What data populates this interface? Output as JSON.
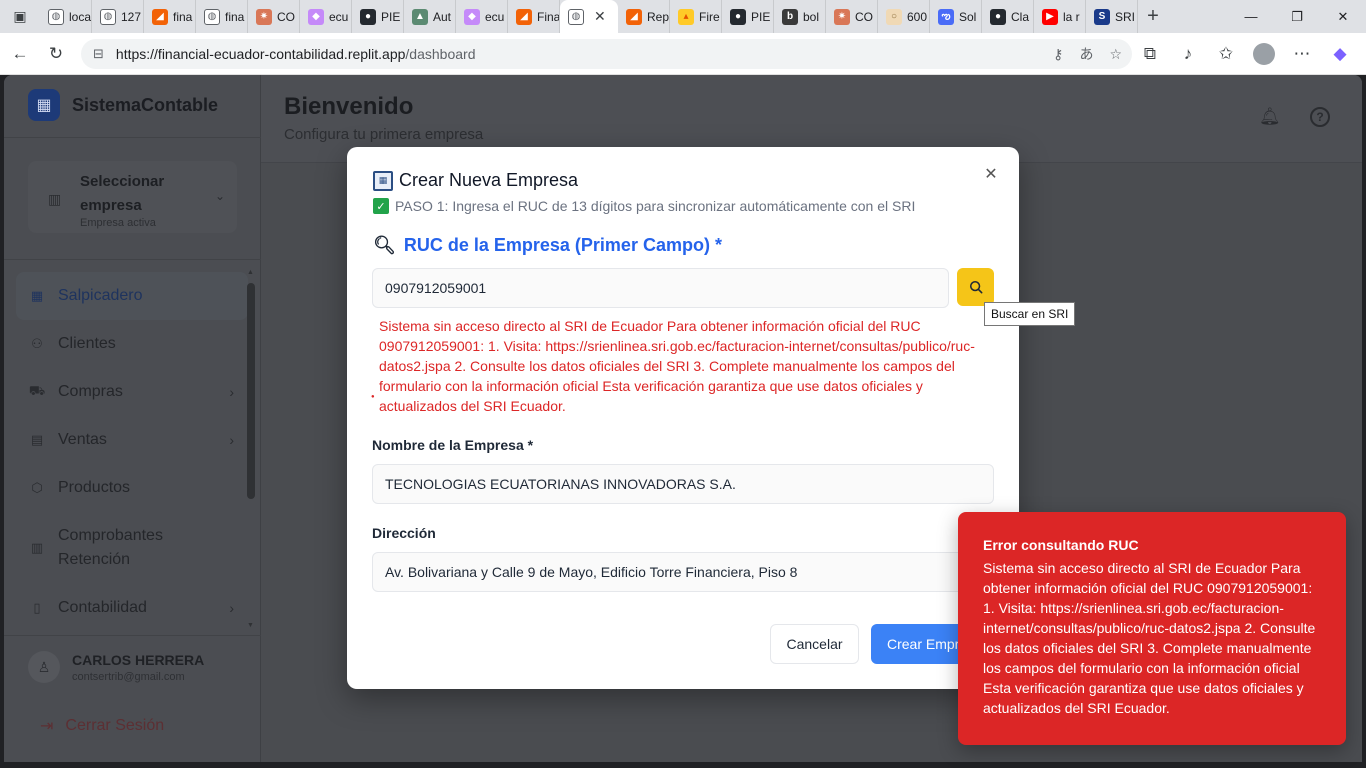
{
  "browser": {
    "tabs": [
      {
        "label": "loca",
        "icon": "globe-icon"
      },
      {
        "label": "127",
        "icon": "globe-icon"
      },
      {
        "label": "fina",
        "icon": "replit-icon"
      },
      {
        "label": "fina",
        "icon": "globe-icon"
      },
      {
        "label": "CO",
        "icon": "claude-icon"
      },
      {
        "label": "ecu",
        "icon": "gemini-icon"
      },
      {
        "label": "PIE",
        "icon": "github-icon"
      },
      {
        "label": "Aut",
        "icon": "app-icon"
      },
      {
        "label": "ecu",
        "icon": "gemini-icon"
      },
      {
        "label": "Fina",
        "icon": "replit-icon"
      },
      {
        "label": "",
        "icon": "globe-icon",
        "active": true
      },
      {
        "label": "Rep",
        "icon": "replit-icon"
      },
      {
        "label": "Fire",
        "icon": "firebase-icon"
      },
      {
        "label": "PIE",
        "icon": "github-icon"
      },
      {
        "label": "bol",
        "icon": "bolt-icon"
      },
      {
        "label": "CO",
        "icon": "claude-icon"
      },
      {
        "label": "600",
        "icon": "coin-icon"
      },
      {
        "label": "Sol",
        "icon": "copilot-icon"
      },
      {
        "label": "Cla",
        "icon": "github-icon"
      },
      {
        "label": "la r",
        "icon": "youtube-icon"
      },
      {
        "label": "SRI",
        "icon": "sri-icon"
      }
    ],
    "url_host": "https://financial-ecuador-contabilidad.replit.app",
    "url_path": "/dashboard"
  },
  "sidebar": {
    "brand": "SistemaContable",
    "company_title": "Seleccionar empresa",
    "company_sub": "Empresa activa",
    "items": [
      {
        "label": "Salpicadero",
        "icon": "grid-icon",
        "active": true,
        "arrow": false
      },
      {
        "label": "Clientes",
        "icon": "users-icon",
        "active": false,
        "arrow": false
      },
      {
        "label": "Compras",
        "icon": "cart-icon",
        "active": false,
        "arrow": true
      },
      {
        "label": "Ventas",
        "icon": "receipt-icon",
        "active": false,
        "arrow": true
      },
      {
        "label": "Productos",
        "icon": "box-icon",
        "active": false,
        "arrow": false
      },
      {
        "label": "Comprobantes Retención",
        "icon": "document-icon",
        "active": false,
        "arrow": false
      },
      {
        "label": "Contabilidad",
        "icon": "book-icon",
        "active": false,
        "arrow": true
      }
    ],
    "user_name": "CARLOS HERRERA",
    "user_email": "contsertrib@gmail.com",
    "logout": "Cerrar Sesión"
  },
  "header": {
    "title": "Bienvenido",
    "subtitle": "Configura tu primera empresa"
  },
  "modal": {
    "title": "Crear Nueva Empresa",
    "step": "PASO 1: Ingresa el RUC de 13 dígitos para sincronizar automáticamente con el SRI",
    "ruc_heading": "RUC de la Empresa (Primer Campo) *",
    "ruc_value": "0907912059001",
    "search_tooltip": "Buscar en SRI",
    "ruc_error": "Sistema sin acceso directo al SRI de Ecuador Para obtener información oficial del RUC 0907912059001: 1. Visita: https://srienlinea.sri.gob.ec/facturacion-internet/consultas/publico/ruc-datos2.jspa 2. Consulte los datos oficiales del SRI 3. Complete manualmente los campos del formulario con la información oficial Esta verificación garantiza que use datos oficiales y actualizados del SRI Ecuador.",
    "name_label": "Nombre de la Empresa *",
    "name_value": "TECNOLOGIAS ECUATORIANAS INNOVADORAS S.A.",
    "address_label": "Dirección",
    "address_value": "Av. Bolivariana y Calle 9 de Mayo, Edificio Torre Financiera, Piso 8",
    "cancel": "Cancelar",
    "create": "Crear Empresa"
  },
  "toast": {
    "title": "Error consultando RUC",
    "body": "Sistema sin acceso directo al SRI de Ecuador Para obtener información oficial del RUC 0907912059001: 1. Visita: https://srienlinea.sri.gob.ec/facturacion-internet/consultas/publico/ruc-datos2.jspa 2. Consulte los datos oficiales del SRI 3. Complete manualmente los campos del formulario con la información oficial Esta verificación garantiza que use datos oficiales y actualizados del SRI Ecuador."
  }
}
